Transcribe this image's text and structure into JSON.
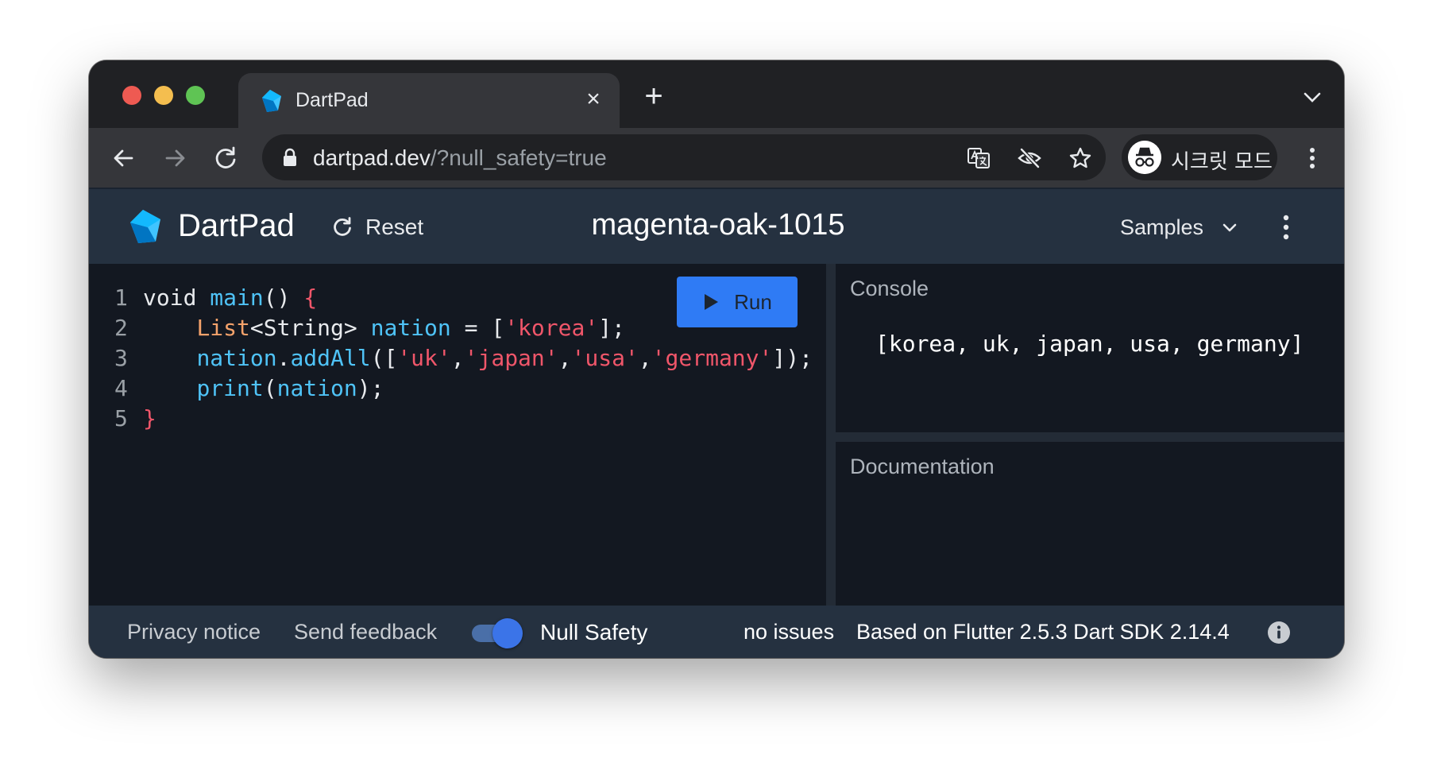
{
  "browser": {
    "tab_title": "DartPad",
    "close_glyph": "×",
    "new_tab_glyph": "+",
    "url_host": "dartpad.dev",
    "url_path": "/?null_safety=true",
    "profile_label": "시크릿 모드",
    "icons": [
      "close-icon",
      "plus-icon",
      "chevron-down-icon",
      "back-arrow-icon",
      "forward-arrow-icon",
      "reload-icon",
      "lock-icon",
      "translate-icon",
      "eye-off-icon",
      "star-icon",
      "incognito-icon",
      "kebab-menu-icon"
    ]
  },
  "header": {
    "app_name": "DartPad",
    "reset_label": "Reset",
    "gist_name": "magenta-oak-1015",
    "samples_label": "Samples"
  },
  "editor": {
    "run_label": "Run",
    "lines": [
      {
        "num": "1"
      },
      {
        "num": "2"
      },
      {
        "num": "3"
      },
      {
        "num": "4"
      },
      {
        "num": "5"
      }
    ],
    "tokens": {
      "l1_void": "void",
      "l1_main": "main",
      "l1_parens": "()",
      "l1_brace": "{",
      "l2_indent": "    ",
      "l2_list": "List",
      "l2_generic": "<String>",
      "l2_nation": "nation",
      "l2_assign": " = [",
      "l2_str": "'korea'",
      "l2_end": "];",
      "l3_indent": "    ",
      "l3_nation": "nation",
      "l3_dot": ".",
      "l3_addall": "addAll",
      "l3_open": "([",
      "l3_s1": "'uk'",
      "l3_c1": ",",
      "l3_s2": "'japan'",
      "l3_c2": ",",
      "l3_s3": "'usa'",
      "l3_c3": ",",
      "l3_s4": "'germany'",
      "l3_end": "]);",
      "l4_indent": "    ",
      "l4_print": "print",
      "l4_open": "(",
      "l4_nation": "nation",
      "l4_end": ");",
      "l5_brace": "}"
    }
  },
  "console": {
    "title": "Console",
    "output": "[korea, uk, japan, usa, germany]"
  },
  "documentation": {
    "title": "Documentation"
  },
  "footer": {
    "privacy_label": "Privacy notice",
    "feedback_label": "Send feedback",
    "null_safety_label": "Null Safety",
    "null_safety_enabled": true,
    "issues_label": "no issues",
    "version_label": "Based on Flutter 2.5.3 Dart SDK 2.14.4"
  },
  "colors": {
    "accent": "#2f7bf5",
    "header_bg": "#253140",
    "editor_bg": "#131821",
    "string": "#f0566a",
    "identifier": "#4fc3f7",
    "type": "#f4a26b"
  }
}
